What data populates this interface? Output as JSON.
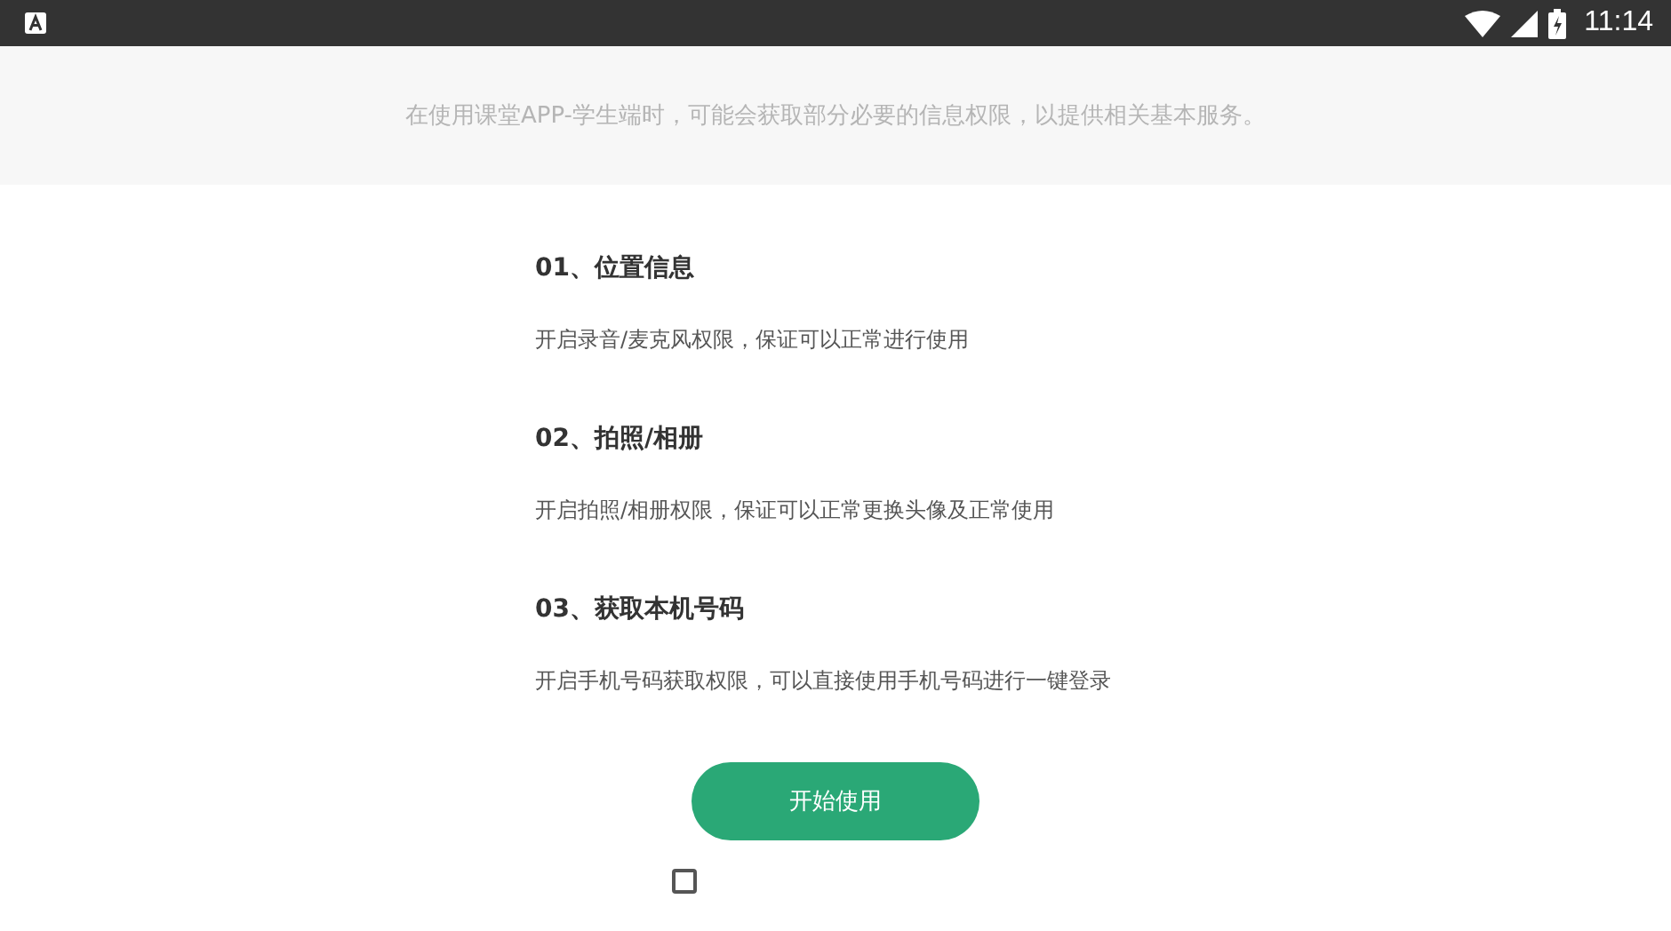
{
  "status_bar": {
    "time": "11:14"
  },
  "notice": "在使用课堂APP-学生端时，可能会获取部分必要的信息权限，以提供相关基本服务。",
  "permissions": [
    {
      "title": "01、位置信息",
      "description": "开启录音/麦克风权限，保证可以正常进行使用"
    },
    {
      "title": "02、拍照/相册",
      "description": "开启拍照/相册权限，保证可以正常更换头像及正常使用"
    },
    {
      "title": "03、获取本机号码",
      "description": "开启手机号码获取权限，可以直接使用手机号码进行一键登录"
    }
  ],
  "start_button": "开始使用",
  "agreement": {
    "checked": false
  }
}
